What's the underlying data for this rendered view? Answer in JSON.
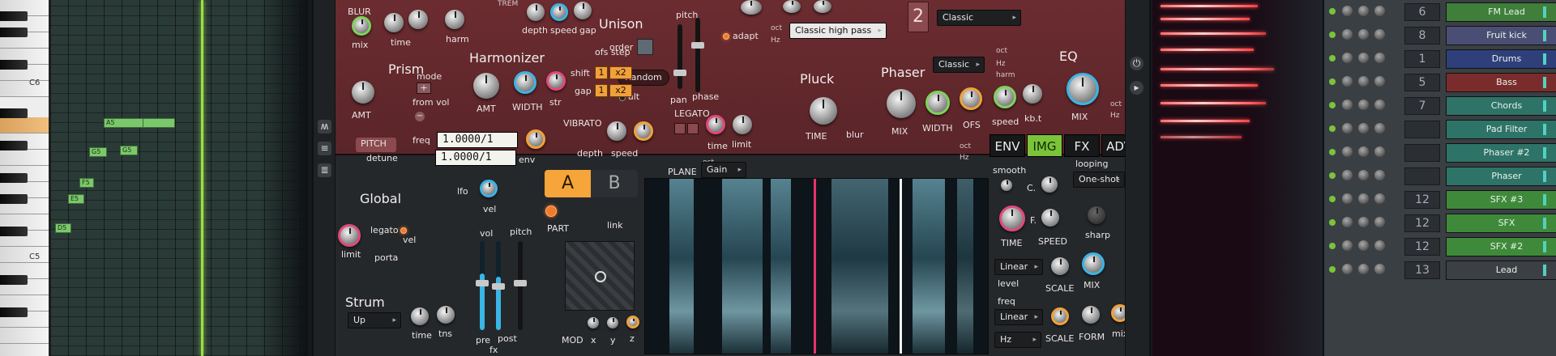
{
  "piano": {
    "labels": [
      "C6",
      "C5"
    ],
    "notes": [
      "A5",
      "G5",
      "G5",
      "F5",
      "E5",
      "D5"
    ]
  },
  "synth": {
    "blur": {
      "title": "BLUR",
      "mix": "mix",
      "time": "time",
      "harm": "harm"
    },
    "trem": {
      "title": "TREM",
      "depth": "depth",
      "speed": "speed",
      "gap": "gap"
    },
    "unison": {
      "title": "Unison",
      "order": "order",
      "order_mode": "Random",
      "alt": "alt",
      "pitch": "pitch",
      "pan": "pan",
      "phase": "phase"
    },
    "filter": {
      "adapt": "adapt",
      "oct": "oct",
      "hz": "Hz",
      "mode": "Classic high pass",
      "badge": "2",
      "mode2": "Classic"
    },
    "prism": {
      "title": "Prism",
      "mode": "mode",
      "from_vol": "from vol",
      "amt": "AMT"
    },
    "harmonizer": {
      "title": "Harmonizer",
      "ofs_step": "ofs step",
      "shift": "shift",
      "gap": "gap",
      "shift_val": "1",
      "shift_x": "x2",
      "gap_val": "1",
      "gap_x": "x2",
      "amt": "AMT",
      "width": "WIDTH",
      "str": "str"
    },
    "pitch_box": {
      "title": "PITCH",
      "freq": "freq",
      "detune": "detune",
      "freq_val": "1.0000/1",
      "detune_val": "1.0000/1",
      "oct": "oct",
      "hz": "Hz",
      "env": "env"
    },
    "vibrato": {
      "title": "VIBRATO",
      "depth": "depth",
      "speed": "speed"
    },
    "legato": {
      "title": "LEGATO",
      "time": "time",
      "limit": "limit"
    },
    "pluck": {
      "title": "Pluck",
      "time": "TIME",
      "blur": "blur"
    },
    "phaser": {
      "title": "Phaser",
      "mode": "Classic",
      "oct": "oct",
      "hz": "Hz",
      "harm": "harm",
      "mix": "MIX",
      "width": "WIDTH",
      "ofs": "OFS",
      "speed": "speed",
      "kbt": "kb.t"
    },
    "eq": {
      "title": "EQ",
      "mix": "MIX",
      "oct": "oct",
      "hz": "Hz"
    },
    "global": {
      "title": "Global",
      "lfo": "lfo",
      "vel": "vel",
      "legato": "legato",
      "vel2": "vel",
      "porta": "porta",
      "limit": "limit",
      "strum": "Strum",
      "strum_mode": "Up",
      "time": "time",
      "tns": "tns",
      "vol": "vol",
      "pitch": "pitch",
      "pre": "pre",
      "post": "post",
      "fx": "fx"
    },
    "part": {
      "a": "A",
      "b": "B",
      "part": "PART",
      "link": "link",
      "mod": "MOD",
      "x": "x",
      "y": "y",
      "z": "z"
    },
    "plane": {
      "title": "PLANE",
      "mode": "Gain",
      "oct": "oct",
      "hz": "Hz"
    },
    "tabs": [
      "ENV",
      "IMG",
      "FX",
      "ADV"
    ],
    "active_tab": "IMG",
    "img": {
      "smooth": "smooth",
      "c": "C.",
      "f": "F.",
      "looping": "looping",
      "loop_mode": "One-shot",
      "time": "TIME",
      "speed": "SPEED",
      "sharp": "sharp",
      "level_mode": "Linear",
      "level": "level",
      "scale": "SCALE",
      "mix": "MIX",
      "freq": "freq",
      "freq_mode": "Linear",
      "scale2": "SCALE",
      "form": "FORM",
      "mix2": "mix",
      "hz": "Hz"
    },
    "colors": {
      "red_panel": "#6b2c30",
      "accent_green": "#7bc43a",
      "accent_orange": "#f5a53a",
      "accent_blue": "#3ab5e6",
      "accent_pink": "#e8326e"
    }
  },
  "rack": {
    "channels": [
      {
        "num": "6",
        "name": "FM Lead",
        "color": "#3f7f3a"
      },
      {
        "num": "8",
        "name": "Fruit kick",
        "color": "#4b4e74"
      },
      {
        "num": "1",
        "name": "Drums",
        "color": "#2e3f7a"
      },
      {
        "num": "5",
        "name": "Bass",
        "color": "#7a2c2c"
      },
      {
        "num": "7",
        "name": "Chords",
        "color": "#2e7368"
      },
      {
        "num": "",
        "name": "Pad Filter",
        "color": "#2e7368"
      },
      {
        "num": "",
        "name": "Phaser #2",
        "color": "#2e7368"
      },
      {
        "num": "",
        "name": "Phaser",
        "color": "#2e7368"
      },
      {
        "num": "12",
        "name": "SFX #3",
        "color": "#3f8a3a"
      },
      {
        "num": "12",
        "name": "SFX",
        "color": "#3f8a3a"
      },
      {
        "num": "12",
        "name": "SFX #2",
        "color": "#3f8a3a"
      },
      {
        "num": "13",
        "name": "Lead",
        "color": "#3c4045"
      }
    ]
  }
}
